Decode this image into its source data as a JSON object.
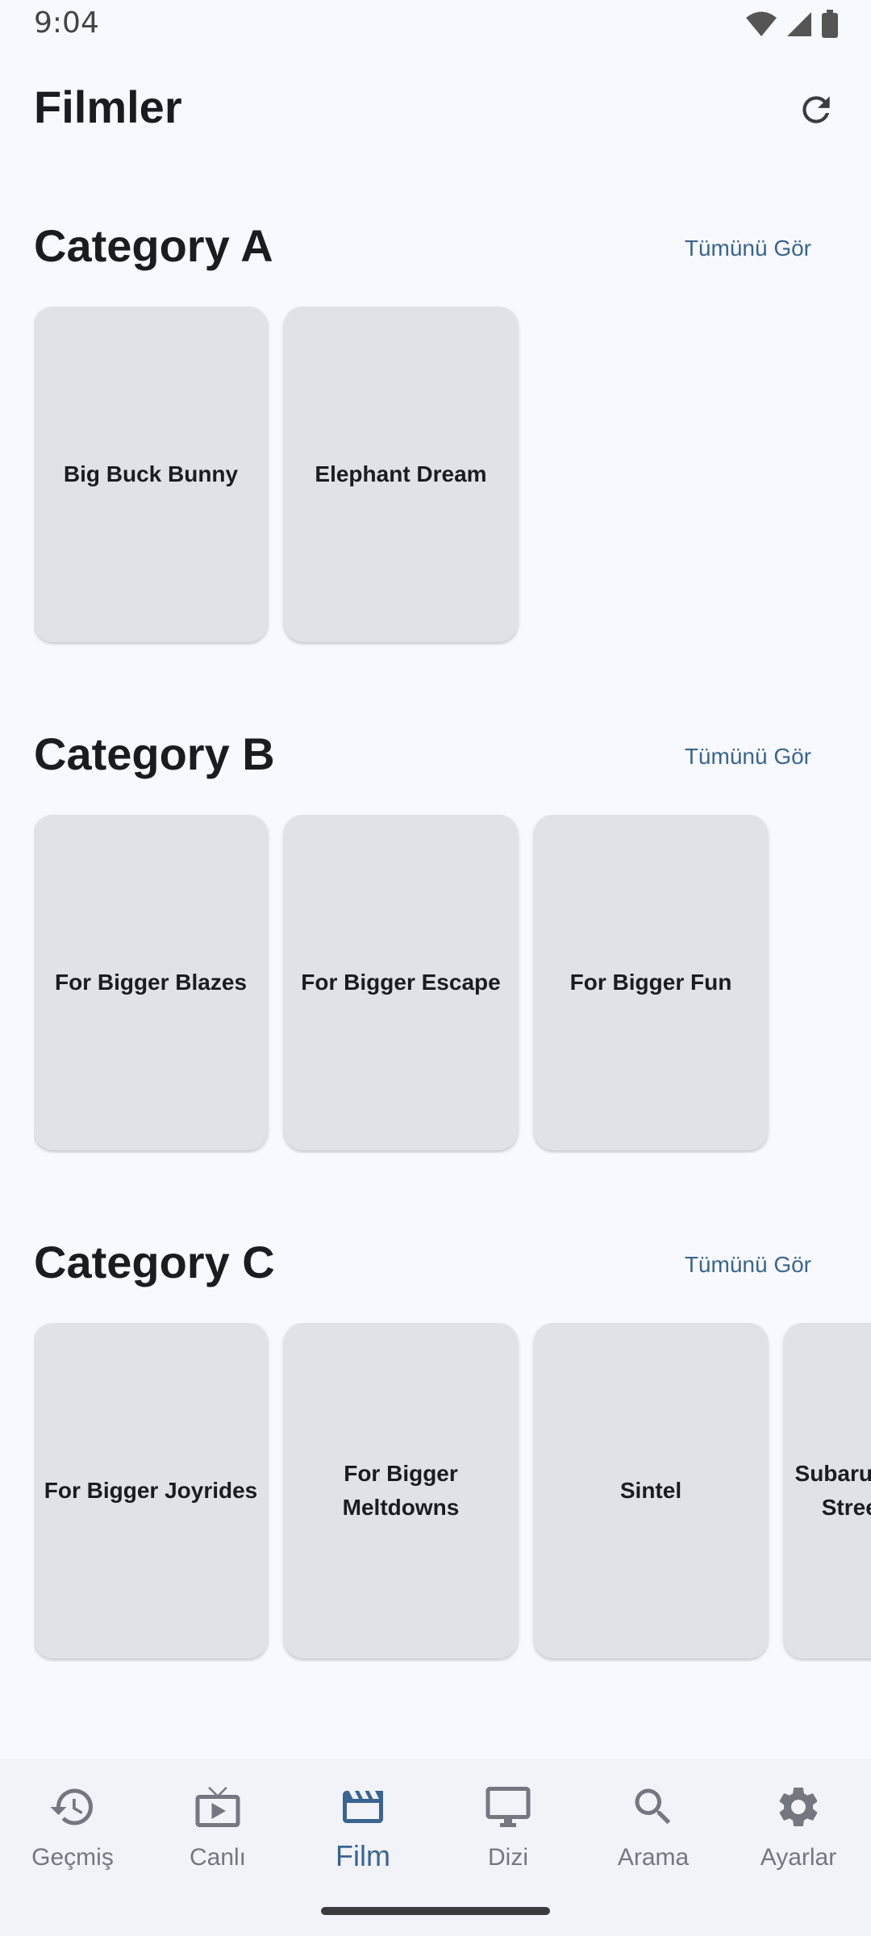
{
  "status_bar": {
    "time": "9:04",
    "icons": [
      "wifi-icon",
      "signal-icon",
      "battery-icon"
    ]
  },
  "app_bar": {
    "title": "Filmler",
    "refresh_icon": "refresh-icon"
  },
  "sections": [
    {
      "title": "Category A",
      "see_all": "Tümünü Gör",
      "items": [
        "Big Buck Bunny",
        "Elephant Dream"
      ]
    },
    {
      "title": "Category B",
      "see_all": "Tümünü Gör",
      "items": [
        "For Bigger Blazes",
        "For Bigger Escape",
        "For Bigger Fun"
      ]
    },
    {
      "title": "Category C",
      "see_all": "Tümünü Gör",
      "items": [
        "For Bigger Joyrides",
        "For Bigger Meltdowns",
        "Sintel",
        "Subaru Outback On Street And Dirt"
      ]
    }
  ],
  "bottom_nav": {
    "items": [
      {
        "label": "Geçmiş",
        "icon": "history-icon",
        "active": false
      },
      {
        "label": "Canlı",
        "icon": "live-tv-icon",
        "active": false
      },
      {
        "label": "Film",
        "icon": "movie-icon",
        "active": true
      },
      {
        "label": "Dizi",
        "icon": "tv-icon",
        "active": false
      },
      {
        "label": "Arama",
        "icon": "search-icon",
        "active": false
      },
      {
        "label": "Ayarlar",
        "icon": "settings-icon",
        "active": false
      }
    ]
  },
  "colors": {
    "background": "#f7f9fe",
    "accent": "#3a6491",
    "card": "#e1e2e7",
    "nav_background": "#f1f3f8",
    "inactive": "#74777f"
  }
}
